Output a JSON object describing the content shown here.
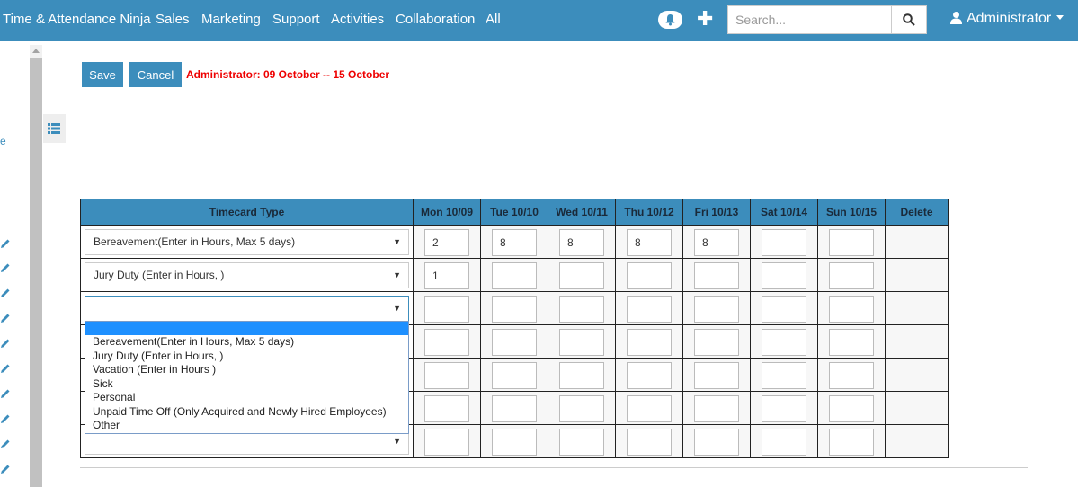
{
  "topnav": {
    "items": [
      "Time & Attendance Ninja",
      "Sales",
      "Marketing",
      "Support",
      "Activities",
      "Collaboration",
      "All"
    ],
    "search_placeholder": "Search...",
    "user_label": "Administrator",
    "bell_icon": "bell-icon",
    "plus_icon": "plus-icon",
    "search_icon": "search-icon",
    "brand_color": "#3c8dbc"
  },
  "sidebar": {
    "partial_text": "e",
    "edit_icon": "pencil-icon",
    "toggle_icon": "list-icon"
  },
  "actions": {
    "save_label": "Save",
    "cancel_label": "Cancel",
    "period_label": "Administrator: 09 October -- 15 October",
    "period_color": "#e00000"
  },
  "grid": {
    "headers": [
      "Timecard Type",
      "Mon 10/09",
      "Tue 10/10",
      "Wed 10/11",
      "Thu 10/12",
      "Fri 10/13",
      "Sat 10/14",
      "Sun 10/15",
      "Delete"
    ],
    "rows": [
      {
        "type": "Bereavement(Enter in Hours, Max 5 days)",
        "hours": [
          "2",
          "8",
          "8",
          "8",
          "8",
          "",
          ""
        ]
      },
      {
        "type": "Jury Duty (Enter in Hours, )",
        "hours": [
          "1",
          "",
          "",
          "",
          "",
          "",
          ""
        ]
      },
      {
        "type": "",
        "hours": [
          "",
          "",
          "",
          "",
          "",
          "",
          ""
        ]
      },
      {
        "type": "",
        "hours": [
          "",
          "",
          "",
          "",
          "",
          "",
          ""
        ]
      },
      {
        "type": "",
        "hours": [
          "",
          "",
          "",
          "",
          "",
          "",
          ""
        ]
      },
      {
        "type": "",
        "hours": [
          "",
          "",
          "",
          "",
          "",
          "",
          ""
        ]
      },
      {
        "type": "",
        "hours": [
          "",
          "",
          "",
          "",
          "",
          "",
          ""
        ]
      }
    ]
  },
  "dropdown": {
    "options": [
      "",
      "Bereavement(Enter in Hours, Max 5 days)",
      "Jury Duty (Enter in Hours, )",
      "Vacation (Enter in Hours )",
      "Sick",
      "Personal",
      "Unpaid Time Off (Only Acquired and Newly Hired Employees)",
      "Other"
    ],
    "highlighted_index": 0
  }
}
